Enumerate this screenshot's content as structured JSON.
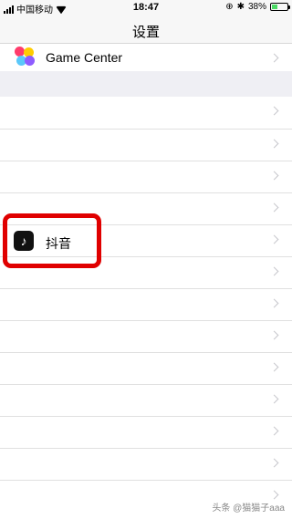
{
  "status_bar": {
    "carrier": "中国移动",
    "time": "18:47",
    "battery_percent": "38%",
    "battery_level": 0.38,
    "battery_color": "#4cd964"
  },
  "nav": {
    "title": "设置"
  },
  "top_section": {
    "game_center_label": "Game Center",
    "icon": "game-center-icon"
  },
  "apps": {
    "highlighted_row_label": "抖音",
    "highlight_color": "#e00000",
    "douyin_icon": "douyin-icon"
  },
  "watermark": "头条 @猫猫子aaa"
}
